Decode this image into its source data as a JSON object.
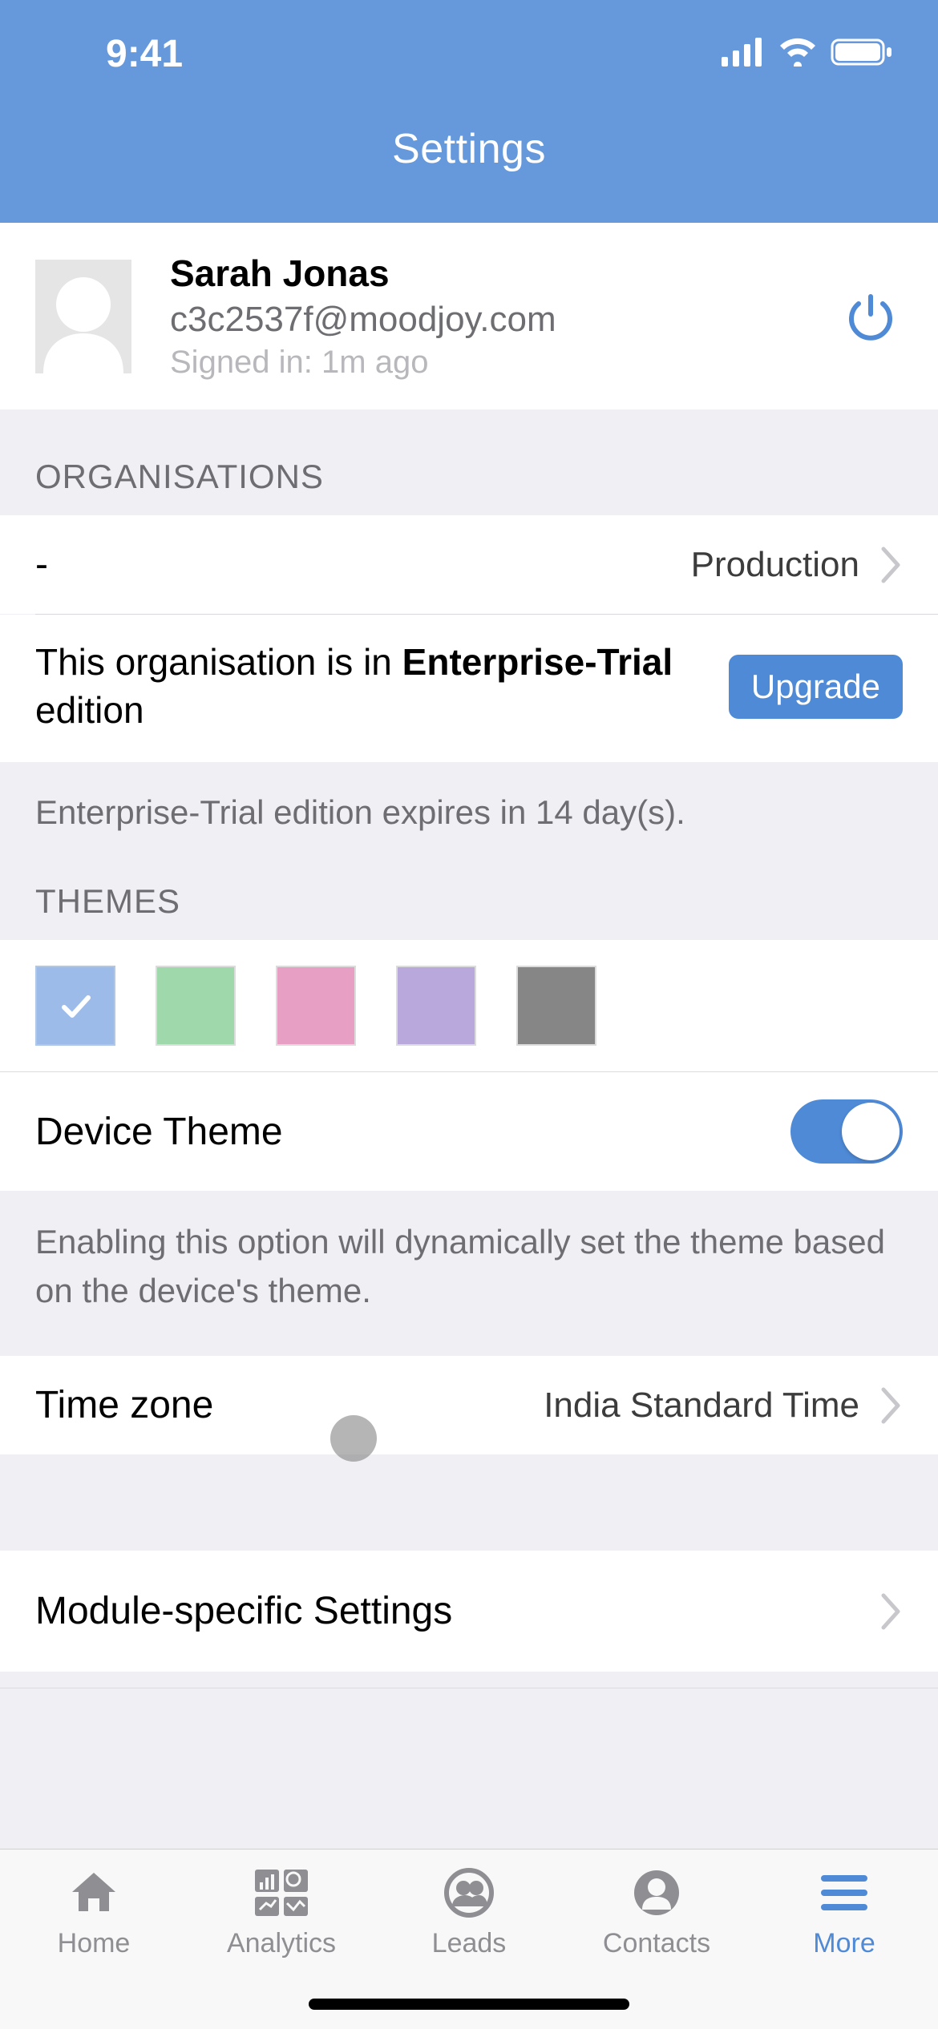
{
  "status": {
    "time": "9:41"
  },
  "header": {
    "title": "Settings"
  },
  "profile": {
    "name": "Sarah Jonas",
    "email": "c3c2537f@moodjoy.com",
    "signed_in": "Signed in: 1m ago"
  },
  "sections": {
    "organisations": {
      "header": "ORGANISATIONS",
      "org_name": "-",
      "org_env": "Production",
      "edition_prefix": "This organisation is in ",
      "edition_bold": "Enterprise-Trial",
      "edition_suffix": " edition",
      "upgrade_label": "Upgrade",
      "expiry_note": "Enterprise-Trial edition expires in 14 day(s)."
    },
    "themes": {
      "header": "THEMES",
      "device_theme_label": "Device Theme",
      "device_theme_on": true,
      "description": "Enabling this option will dynamically set the theme based on the device's theme.",
      "colors": [
        {
          "name": "blue",
          "hex": "#9cbbe9",
          "selected": true
        },
        {
          "name": "green",
          "hex": "#9fd8ab",
          "selected": false
        },
        {
          "name": "pink",
          "hex": "#e79fc3",
          "selected": false
        },
        {
          "name": "purple",
          "hex": "#b9a8db",
          "selected": false
        },
        {
          "name": "gray",
          "hex": "#868686",
          "selected": false
        }
      ]
    },
    "timezone": {
      "label": "Time zone",
      "value": "India Standard Time"
    },
    "module": {
      "label": "Module-specific Settings"
    }
  },
  "tabs": {
    "home": "Home",
    "analytics": "Analytics",
    "leads": "Leads",
    "contacts": "Contacts",
    "more": "More"
  },
  "accent": "#4f8ad6"
}
